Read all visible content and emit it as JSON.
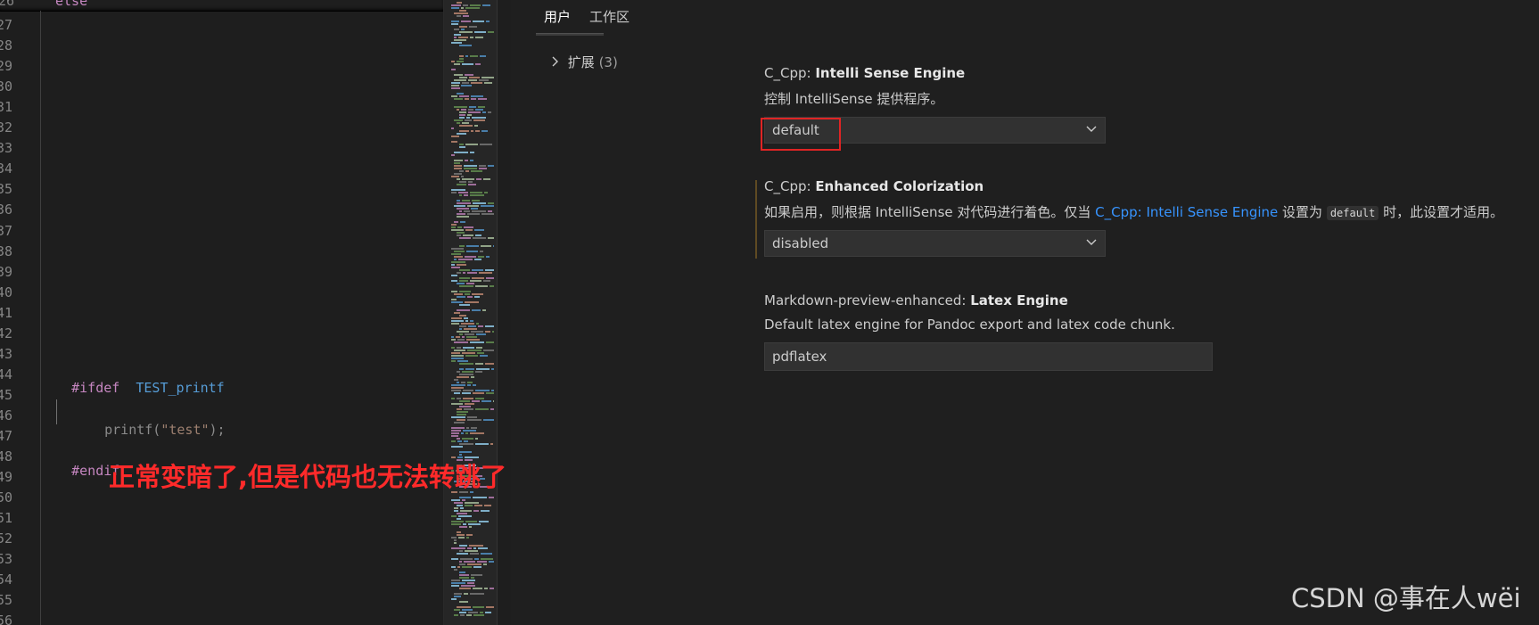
{
  "editor": {
    "partial_line_number": "26",
    "partial_line_text": "else",
    "line_numbers": [
      "27",
      "28",
      "29",
      "30",
      "31",
      "32",
      "33",
      "34",
      "35",
      "36",
      "37",
      "38",
      "39",
      "40",
      "41",
      "42",
      "43",
      "44",
      "45",
      "46",
      "47",
      "48",
      "49",
      "50",
      "51",
      "52",
      "53",
      "54",
      "55",
      "56"
    ],
    "code": {
      "ifdef_keyword": "#ifdef",
      "ifdef_macro": "TEST_printf",
      "printf_fn": "printf(",
      "printf_str": "\"test\"",
      "printf_end": ");",
      "endif_keyword": "#endif"
    }
  },
  "annotation": "正常变暗了,但是代码也无法转跳了",
  "settings": {
    "tabs": {
      "user": "用户",
      "workspace": "工作区"
    },
    "tree": {
      "label": "扩展",
      "count": "(3)"
    },
    "items": [
      {
        "prefix": "C_Cpp: ",
        "name": "Intelli Sense Engine",
        "description": "控制 IntelliSense 提供程序。",
        "value": "default"
      },
      {
        "prefix": "C_Cpp: ",
        "name": "Enhanced Colorization",
        "description_before": "如果启用，则根据 IntelliSense 对代码进行着色。仅当 ",
        "description_link": "C_Cpp: Intelli Sense Engine",
        "description_mid": " 设置为 ",
        "description_code": "default",
        "description_after": " 时，此设置才适用。",
        "value": "disabled"
      },
      {
        "prefix": "Markdown-preview-enhanced: ",
        "name": "Latex Engine",
        "description": "Default latex engine for Pandoc export and latex code chunk.",
        "value": "pdflatex"
      }
    ]
  },
  "watermark": "CSDN @事在人wëi",
  "colors": {
    "keyword": "#c586c0",
    "macro": "#569cd6",
    "link": "#3794ff",
    "annotation": "#ff2a2a"
  }
}
